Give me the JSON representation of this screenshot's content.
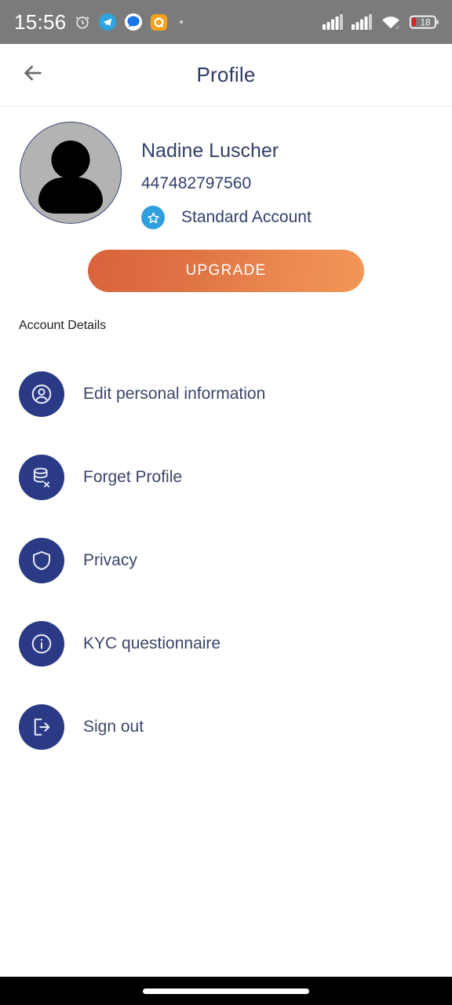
{
  "status_bar": {
    "time": "15:56",
    "icons_left": [
      "alarm-clock-icon",
      "telegram-icon",
      "messages-icon",
      "orange-app-icon",
      "notification-dot"
    ],
    "icons_right": [
      "signal-sim1-icon",
      "signal-sim2-icon",
      "wifi-icon",
      "battery-icon"
    ],
    "battery_percent": "18",
    "background_color": "#7b7b7b"
  },
  "app_bar": {
    "back_icon": "arrow-left-icon",
    "title": "Profile"
  },
  "profile": {
    "avatar_icon": "person-avatar-placeholder",
    "name": "Nadine Luscher",
    "phone": "447482797560",
    "badge_icon": "star-icon",
    "badge_color": "#2fa0dd",
    "account_type": "Standard Account"
  },
  "upgrade": {
    "label": "UPGRADE",
    "gradient_from": "#d9623c",
    "gradient_to": "#f09757"
  },
  "account_details": {
    "section_label": "Account Details",
    "icon_color": "#2b3a85",
    "items": [
      {
        "label": "Edit personal information",
        "icon": "user-circle-icon"
      },
      {
        "label": "Forget Profile",
        "icon": "database-remove-icon"
      },
      {
        "label": "Privacy",
        "icon": "shield-icon"
      },
      {
        "label": "KYC questionnaire",
        "icon": "info-circle-icon"
      },
      {
        "label": "Sign out",
        "icon": "logout-icon"
      }
    ]
  },
  "nav_bar": {
    "gesture_pill": "home-gesture-pill"
  }
}
